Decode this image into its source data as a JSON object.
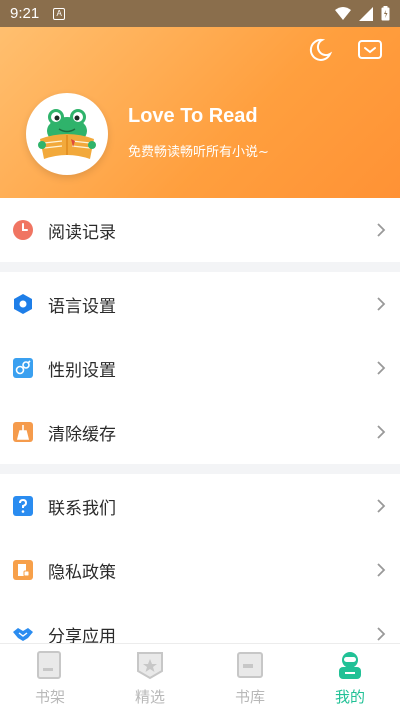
{
  "status_bar": {
    "time": "9:21",
    "notification_icon": "A"
  },
  "header": {
    "title": "Love To Read",
    "subtitle": "免费畅读畅听所有小说~",
    "night_mode_icon": "moon-icon",
    "message_icon": "mail-icon"
  },
  "menu_groups": [
    {
      "items": [
        {
          "label": "阅读记录",
          "icon": "clock-icon",
          "color": "#f07562"
        }
      ]
    },
    {
      "items": [
        {
          "label": "语言设置",
          "icon": "hexagon-icon",
          "color": "#1e7ee8"
        },
        {
          "label": "性别设置",
          "icon": "gender-icon",
          "color": "#3aa0f0"
        },
        {
          "label": "清除缓存",
          "icon": "broom-icon",
          "color": "#f59b4c"
        }
      ]
    },
    {
      "items": [
        {
          "label": "联系我们",
          "icon": "question-icon",
          "color": "#2a8cf0"
        },
        {
          "label": "隐私政策",
          "icon": "document-lock-icon",
          "color": "#f7a04a"
        },
        {
          "label": "分享应用",
          "icon": "handshake-icon",
          "color": "#2a8cf0"
        }
      ]
    }
  ],
  "bottom_nav": {
    "tabs": [
      {
        "label": "书架",
        "icon": "bookshelf-icon",
        "active": false
      },
      {
        "label": "精选",
        "icon": "featured-star-icon",
        "active": false
      },
      {
        "label": "书库",
        "icon": "library-icon",
        "active": false
      },
      {
        "label": "我的",
        "icon": "profile-icon",
        "active": true
      }
    ],
    "active_color": "#21c196",
    "inactive_color": "#b8b8b8"
  }
}
